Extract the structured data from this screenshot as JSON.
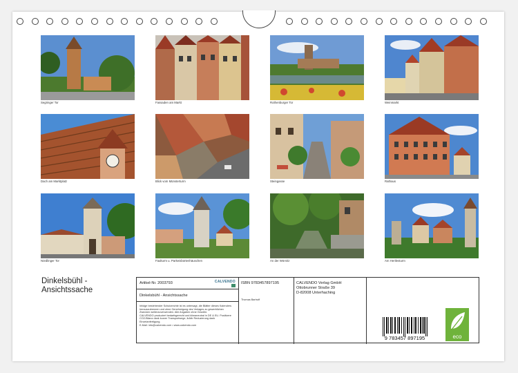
{
  "calendar": {
    "title_line1": "Dinkelsbühl -",
    "title_line2": "Ansichtssache"
  },
  "photos": [
    {
      "caption": "Segringer Tor"
    },
    {
      "caption": "Fassaden am Markt"
    },
    {
      "caption": "Rothenburger Tor"
    },
    {
      "caption": "Weinmarkt"
    },
    {
      "caption": "Dach am Marktplatz"
    },
    {
      "caption": "Blick vom Münsterturm"
    },
    {
      "caption": "Steingasse"
    },
    {
      "caption": "Rathaus"
    },
    {
      "caption": "Nördlinger Tor"
    },
    {
      "caption": "Faulturm u. Parkeisbürtenhäuschen"
    },
    {
      "caption": "An der Wörnitz"
    },
    {
      "caption": "Am Hertlesturm"
    }
  ],
  "info": {
    "article_no": "Artikel-Nr. 2003793",
    "publisher_logo": "CALVENDO",
    "product_title": "Dinkelsbühl - Ansichtssache",
    "isbn": "ISBN 9783457897195",
    "author": "Thomas Bartruff",
    "publisher_name": "CALVENDO Verlag GmbH",
    "publisher_street": "Ottobrunner Straße 39",
    "publisher_city": "D-82008 Unterhaching",
    "legal_text_1": "Infolge bestehender Schutzrechte ist es untersagt, die Blätter dieses Kalenders herauszutrennen und ohne Genehmigung des Verlages zu gewerblichen Zwecken weiterzuverwenden. Alle Angaben ohne Gewähr.",
    "legal_text_2": "CALVENDO produziert bedarfsgerecht und klimaneutral in DE & EU. Positivere CO2-Bilanz dank kurzer Transportwege, ibAttr Reduzierung dank Einzelanfertigung.",
    "legal_text_3": "E-Mail: info@calvendo.com • www.calvendo.com",
    "barcode_digits": "9 783457 897195",
    "eco_label": "eco"
  }
}
